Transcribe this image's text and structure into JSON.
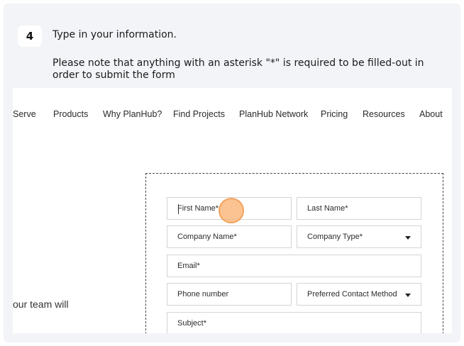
{
  "step": {
    "number": "4",
    "title": "Type in your information.",
    "note": "Please note that anything with an asterisk \"*\" is required to be filled-out in order to submit the form"
  },
  "nav": {
    "items": [
      "Serve",
      "Products",
      "Why PlanHub?",
      "Find Projects",
      "PlanHub Network",
      "Pricing",
      "Resources",
      "About"
    ]
  },
  "side_text": "our team will",
  "form": {
    "first_name": "First Name*",
    "last_name": "Last Name*",
    "company_name": "Company Name*",
    "company_type": "Company Type*",
    "email": "Email*",
    "phone": "Phone number",
    "contact_method": "Preferred Contact Method",
    "subject": "Subject*"
  },
  "colors": {
    "card_background": "#f2f4f7",
    "click_marker": "#f2a25c"
  }
}
